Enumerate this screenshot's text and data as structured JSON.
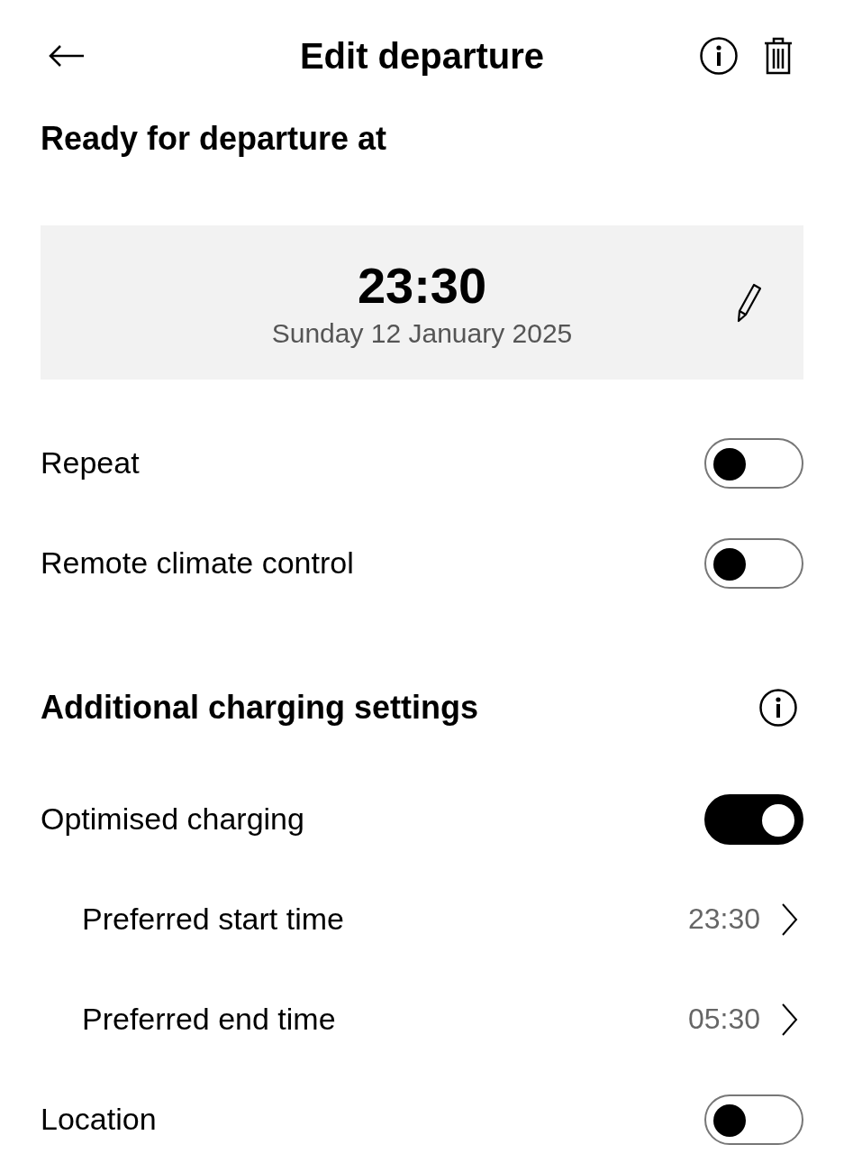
{
  "header": {
    "title": "Edit departure"
  },
  "departure": {
    "heading": "Ready for departure at",
    "time": "23:30",
    "date": "Sunday 12 January 2025"
  },
  "rows": [
    {
      "kind": "toggle",
      "label": "Repeat",
      "on": false
    },
    {
      "kind": "toggle",
      "label": "Remote climate control",
      "on": false
    }
  ],
  "charging": {
    "heading": "Additional charging settings",
    "rows": [
      {
        "kind": "toggle",
        "label": "Optimised charging",
        "on": true,
        "children": [
          {
            "kind": "link",
            "label": "Preferred start time",
            "value": "23:30"
          },
          {
            "kind": "link",
            "label": "Preferred end time",
            "value": "05:30"
          }
        ]
      },
      {
        "kind": "toggle",
        "label": "Location",
        "on": false
      }
    ]
  }
}
